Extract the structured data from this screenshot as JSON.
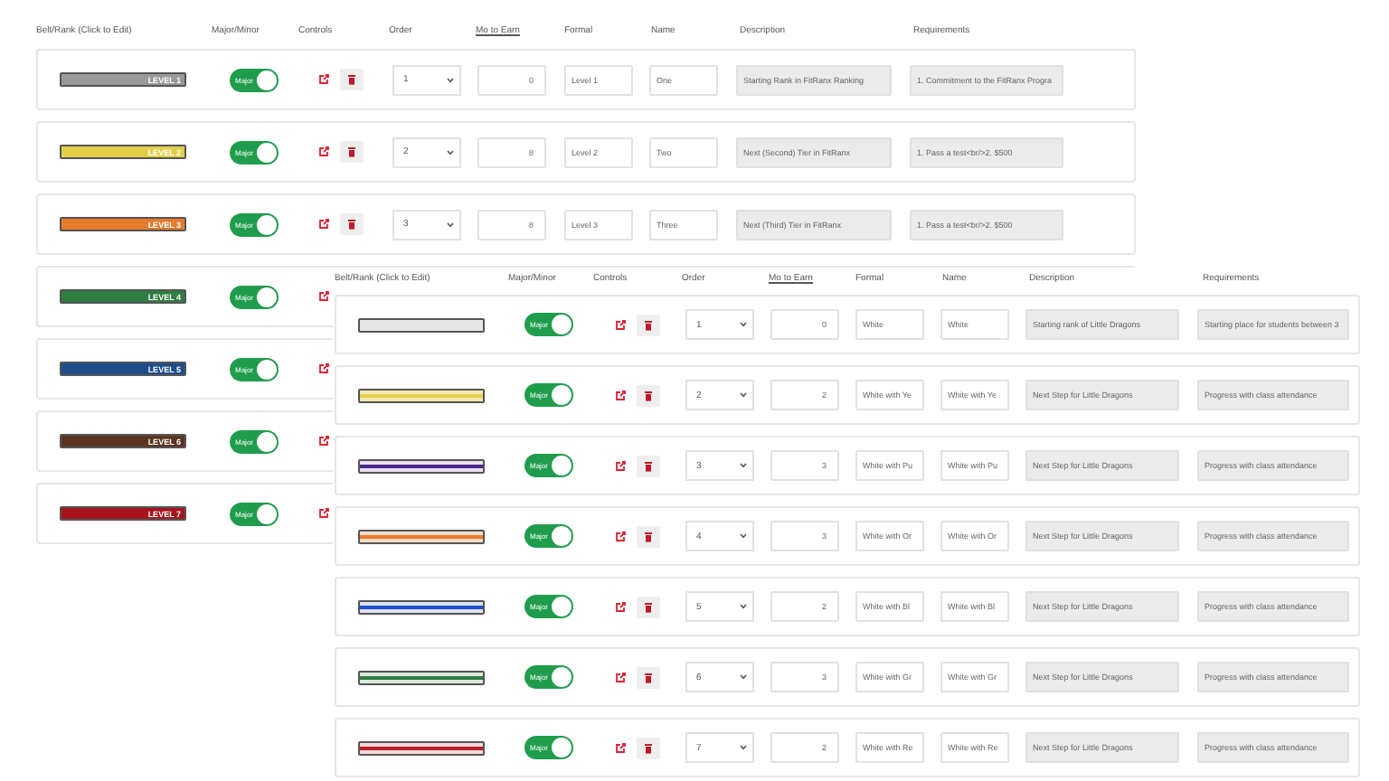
{
  "panels": [
    {
      "columns": [
        {
          "label": "Belt/Rank (Click to Edit)",
          "underlined": false
        },
        {
          "label": "Major/Minor",
          "underlined": false
        },
        {
          "label": "Controls",
          "underlined": false
        },
        {
          "label": "Order",
          "underlined": false
        },
        {
          "label": "Mo to Earn",
          "underlined": true
        },
        {
          "label": "Formal",
          "underlined": false
        },
        {
          "label": "Name",
          "underlined": false
        },
        {
          "label": "Description",
          "underlined": false
        },
        {
          "label": "Requirements",
          "underlined": false
        }
      ],
      "rows": [
        {
          "kind": "full",
          "belt": {
            "label": "LEVEL 1",
            "color": "#9a9a9a"
          },
          "toggle": {
            "label": "Major",
            "on": true
          },
          "order": "1",
          "months": "0",
          "formal": "Level 1",
          "name": "One",
          "description": "Starting Rank in FitRanx Ranking",
          "requirements": "1. Commitment to the FitRanx Progra"
        },
        {
          "kind": "full",
          "belt": {
            "label": "LEVEL 2",
            "color": "#e3d04a"
          },
          "toggle": {
            "label": "Major",
            "on": true
          },
          "order": "2",
          "months": "8",
          "formal": "Level 2",
          "name": "Two",
          "description": "Next (Second) Tier in FitRanx",
          "requirements": "1. Pass a test<br/>2. $500"
        },
        {
          "kind": "full",
          "belt": {
            "label": "LEVEL 3",
            "color": "#e77b2e"
          },
          "toggle": {
            "label": "Major",
            "on": true
          },
          "order": "3",
          "months": "8",
          "formal": "Level 3",
          "name": "Three",
          "description": "Next (Third) Tier in FitRanx",
          "requirements": "1. Pass a test<br/>2. $500"
        },
        {
          "kind": "partial",
          "belt": {
            "label": "LEVEL 4",
            "color": "#2f7d40"
          },
          "toggle": {
            "label": "Major",
            "on": true
          }
        },
        {
          "kind": "partial",
          "belt": {
            "label": "LEVEL 5",
            "color": "#1f4d8a"
          },
          "toggle": {
            "label": "Major",
            "on": true
          }
        },
        {
          "kind": "partial",
          "belt": {
            "label": "LEVEL 6",
            "color": "#5b3522"
          },
          "toggle": {
            "label": "Major",
            "on": true
          }
        },
        {
          "kind": "partial",
          "belt": {
            "label": "LEVEL 7",
            "color": "#a6141d"
          },
          "toggle": {
            "label": "Major",
            "on": true
          }
        }
      ]
    },
    {
      "columns": [
        {
          "label": "Belt/Rank (Click to Edit)",
          "underlined": false
        },
        {
          "label": "Major/Minor",
          "underlined": false
        },
        {
          "label": "Controls",
          "underlined": false
        },
        {
          "label": "Order",
          "underlined": false
        },
        {
          "label": "Mo to Earn",
          "underlined": true
        },
        {
          "label": "Formal",
          "underlined": false
        },
        {
          "label": "Name",
          "underlined": false
        },
        {
          "label": "Description",
          "underlined": false
        },
        {
          "label": "Requirements",
          "underlined": false
        }
      ],
      "rows": [
        {
          "kind": "full",
          "belt": {
            "color": "#e6e6e6"
          },
          "toggle": {
            "label": "Major",
            "on": true
          },
          "order": "1",
          "months": "0",
          "formal": "White",
          "name": "White",
          "description": "Starting rank of Little Dragons",
          "requirements": "Starting place for students between 3"
        },
        {
          "kind": "full",
          "belt": {
            "color": "#f3ebb0",
            "stripe": {
              "color": "#e3d04a"
            }
          },
          "toggle": {
            "label": "Major",
            "on": true
          },
          "order": "2",
          "months": "2",
          "formal": "White with Ye",
          "name": "White with Ye",
          "description": "Next Step for Little Dragons",
          "requirements": "Progress with class attendance"
        },
        {
          "kind": "full",
          "belt": {
            "color": "#e8e0f0",
            "stripe": {
              "color": "#4a2a8a"
            }
          },
          "toggle": {
            "label": "Major",
            "on": true
          },
          "order": "3",
          "months": "3",
          "formal": "White with Pu",
          "name": "White with Pu",
          "description": "Next Step for Little Dragons",
          "requirements": "Progress with class attendance"
        },
        {
          "kind": "full",
          "belt": {
            "color": "#f6dccb",
            "stripe": {
              "color": "#e77b2e"
            }
          },
          "toggle": {
            "label": "Major",
            "on": true
          },
          "order": "4",
          "months": "3",
          "formal": "White with Or",
          "name": "White with Or",
          "description": "Next Step for Little Dragons",
          "requirements": "Progress with class attendance"
        },
        {
          "kind": "full",
          "belt": {
            "color": "#dfe4ee",
            "stripe": {
              "color": "#1f4fd0"
            }
          },
          "toggle": {
            "label": "Major",
            "on": true
          },
          "order": "5",
          "months": "2",
          "formal": "White with Bl",
          "name": "White with Bl",
          "description": "Next Step for Little Dragons",
          "requirements": "Progress with class attendance"
        },
        {
          "kind": "full",
          "belt": {
            "color": "#dfe8dc",
            "stripe": {
              "color": "#2f7d40"
            }
          },
          "toggle": {
            "label": "Major",
            "on": true
          },
          "order": "6",
          "months": "3",
          "formal": "White with Gr",
          "name": "White with Gr",
          "description": "Next Step for Little Dragons",
          "requirements": "Progress with class attendance"
        },
        {
          "kind": "full",
          "belt": {
            "color": "#f2d8d8",
            "stripe": {
              "color": "#b8202a"
            }
          },
          "toggle": {
            "label": "Major",
            "on": true
          },
          "order": "7",
          "months": "2",
          "formal": "White with Re",
          "name": "White with Re",
          "description": "Next Step for Little Dragons",
          "requirements": "Progress with class attendance"
        }
      ]
    }
  ]
}
